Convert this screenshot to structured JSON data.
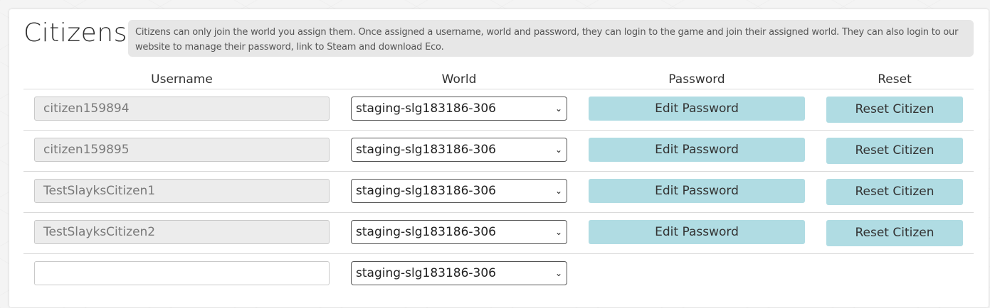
{
  "page": {
    "title": "Citizens",
    "info_text": "Citizens can only join the world you assign them. Once assigned a username, world and password, they can login to the game and join their assigned world. They can also login to our website to manage their password, link to Steam and download Eco."
  },
  "columns": {
    "username": "Username",
    "world": "World",
    "password": "Password",
    "reset": "Reset"
  },
  "rows": [
    {
      "username": "citizen159894",
      "world": "staging-slg183186-306",
      "edit_label": "Edit Password",
      "reset_label": "Reset Citizen"
    },
    {
      "username": "citizen159895",
      "world": "staging-slg183186-306",
      "edit_label": "Edit Password",
      "reset_label": "Reset Citizen"
    },
    {
      "username": "TestSlayksCitizen1",
      "world": "staging-slg183186-306",
      "edit_label": "Edit Password",
      "reset_label": "Reset Citizen"
    },
    {
      "username": "TestSlayksCitizen2",
      "world": "staging-slg183186-306",
      "edit_label": "Edit Password",
      "reset_label": "Reset Citizen"
    }
  ],
  "new_row": {
    "username": "",
    "world": "staging-slg183186-306"
  },
  "icons": {
    "select_arrow": "chevron-down-icon"
  },
  "colors": {
    "button_bg": "#b0dce3",
    "info_bg": "#e7e7e7"
  }
}
